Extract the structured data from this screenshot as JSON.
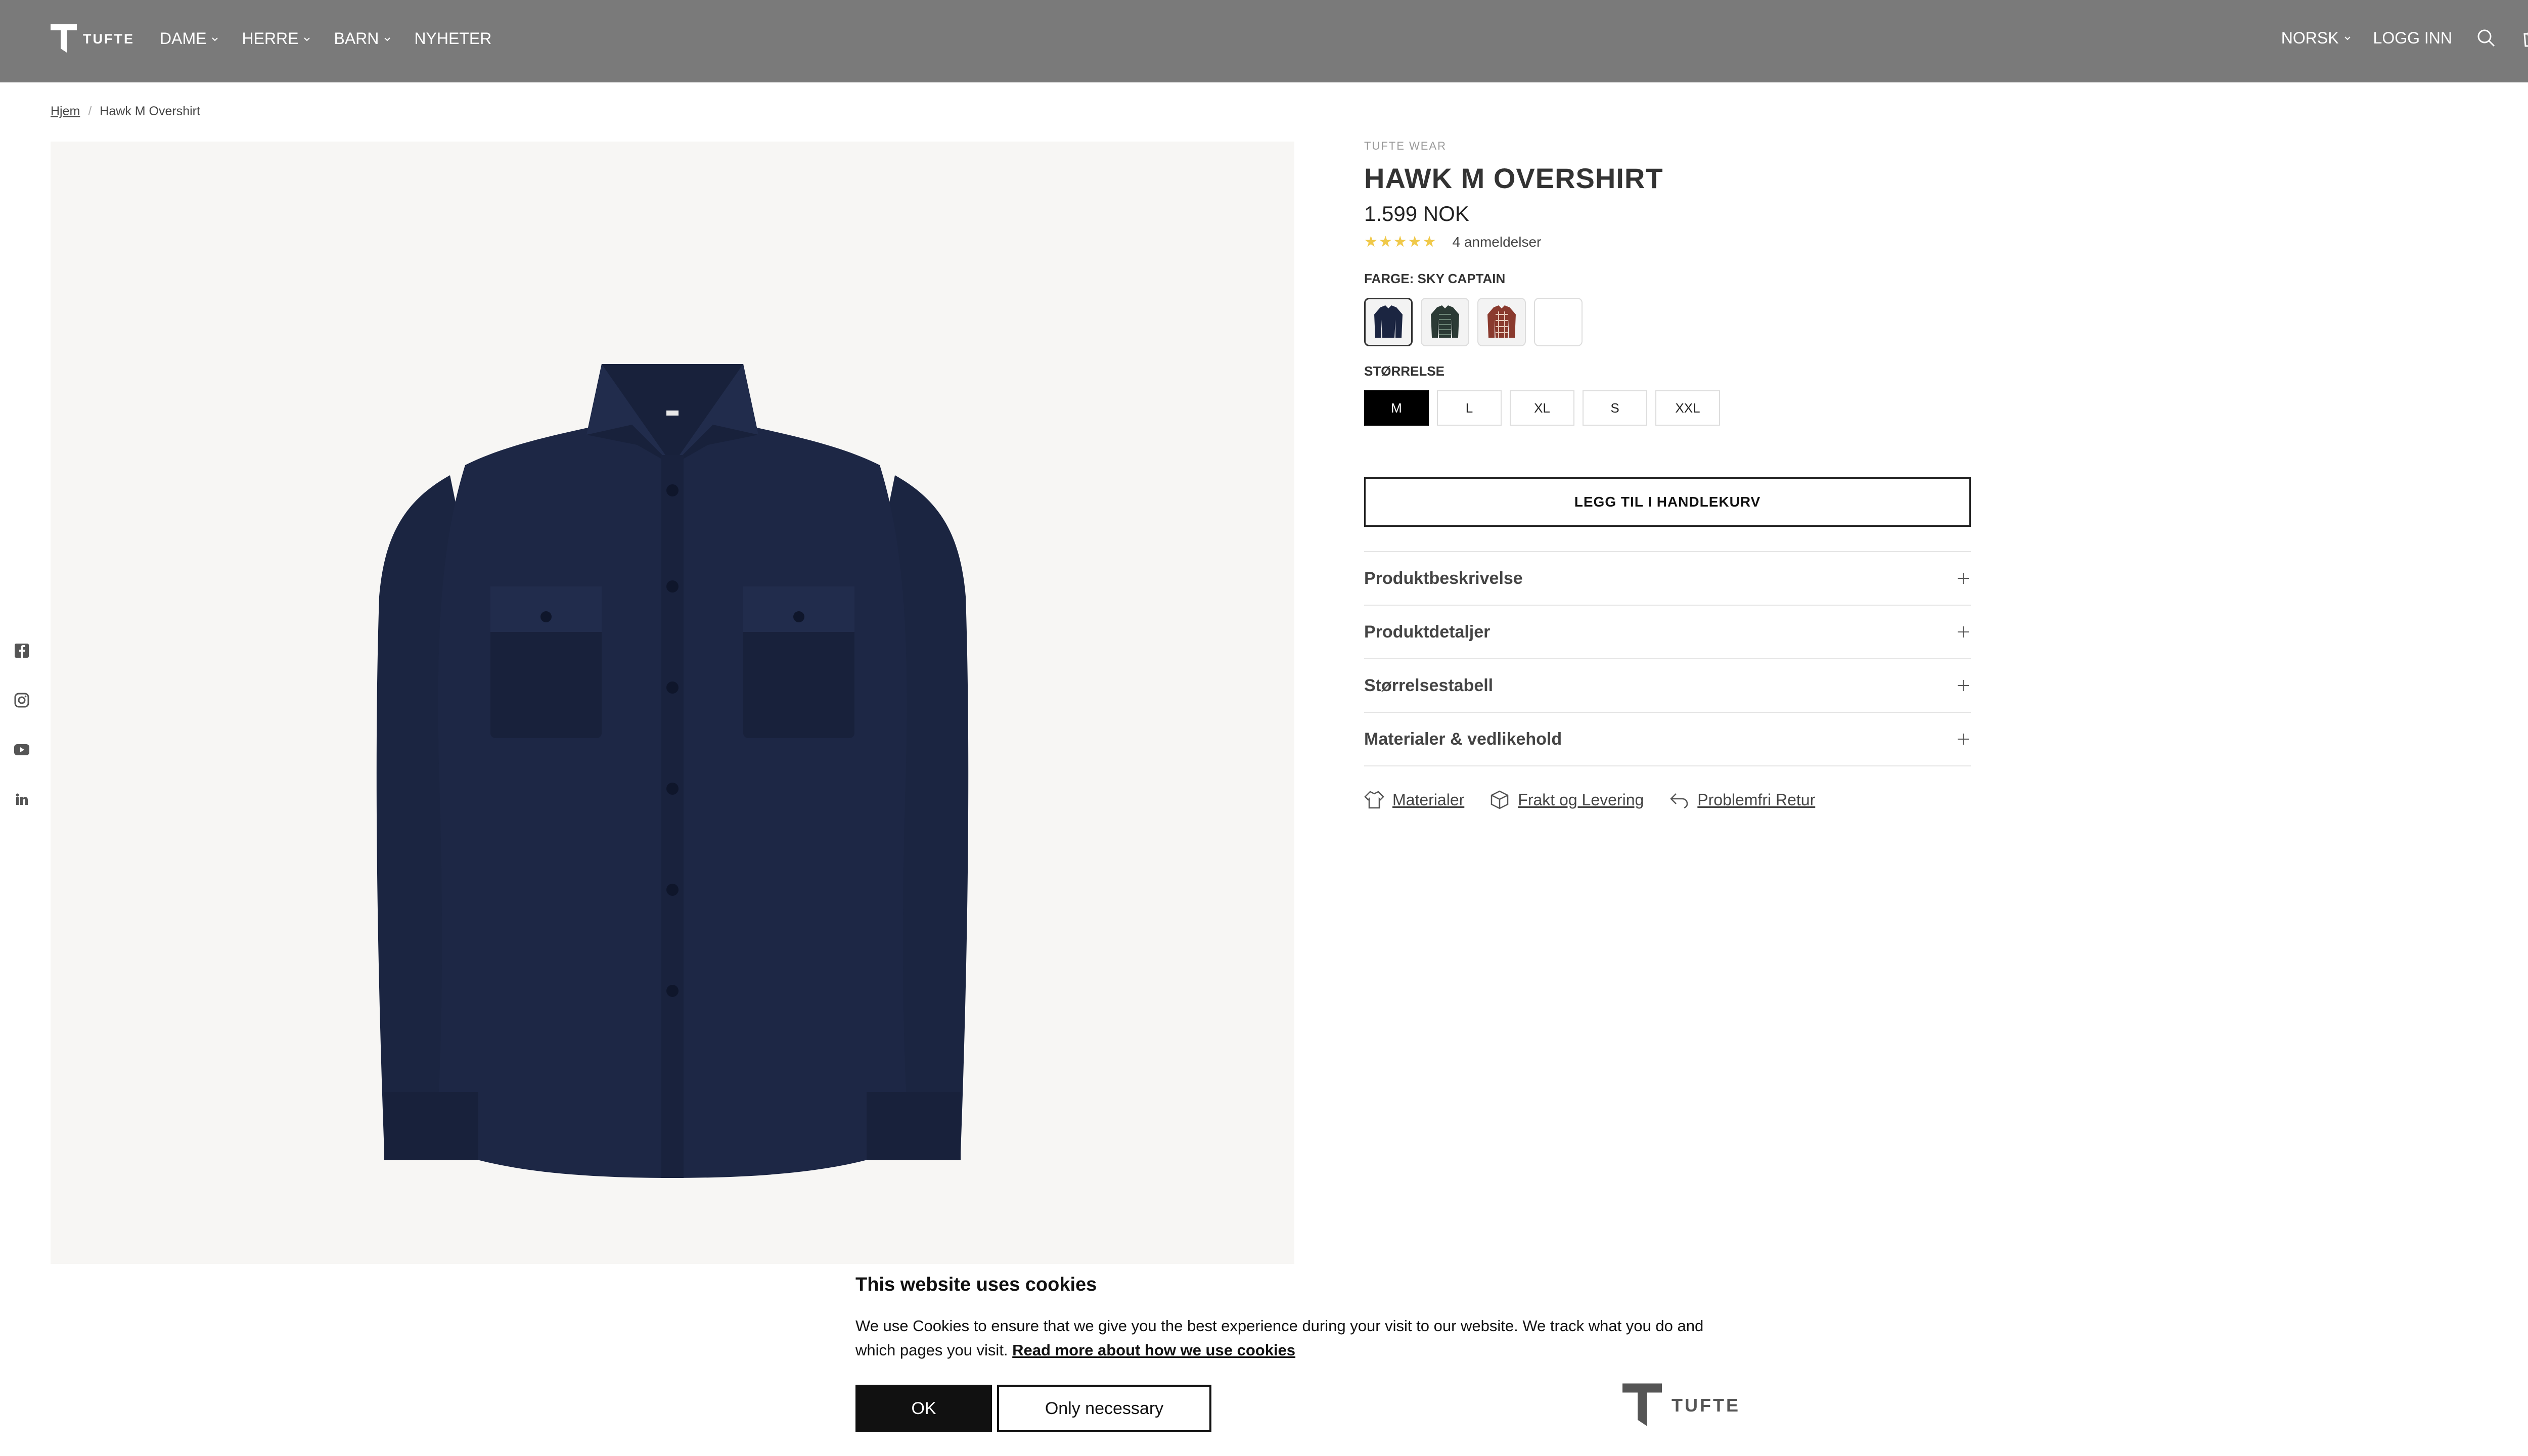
{
  "header": {
    "logo_text": "TUFTE",
    "nav": [
      {
        "label": "DAME",
        "has_dropdown": true
      },
      {
        "label": "HERRE",
        "has_dropdown": true
      },
      {
        "label": "BARN",
        "has_dropdown": true
      },
      {
        "label": "NYHETER",
        "has_dropdown": false
      }
    ],
    "language": "NORSK",
    "login": "LOGG INN",
    "cart_count": "0",
    "background_color": "#7a7a7a"
  },
  "breadcrumb": {
    "home": "Hjem",
    "current": "Hawk M Overshirt"
  },
  "social": [
    "facebook-icon",
    "instagram-icon",
    "youtube-icon",
    "linkedin-icon"
  ],
  "product": {
    "vendor": "TUFTE WEAR",
    "title": "HAWK M OVERSHIRT",
    "price": "1.599 NOK",
    "stars": "★★★★★",
    "reviews": "4 anmeldelser",
    "color_label": "FARGE: SKY CAPTAIN",
    "swatches": [
      "sky-captain",
      "green-check",
      "red-check",
      "blank"
    ],
    "size_label": "STØRRELSE",
    "sizes": [
      "M",
      "L",
      "XL",
      "S",
      "XXL"
    ],
    "selected_size": "M",
    "add_to_cart": "LEGG TIL I HANDLEKURV",
    "accordion": [
      "Produktbeskrivelse",
      "Produktdetaljer",
      "Størrelsestabell",
      "Materialer & vedlikehold"
    ],
    "feature_links": [
      "Materialer",
      "Frakt og Levering",
      "Problemfri Retur"
    ],
    "shirt_color": "#1b2541"
  },
  "cookie": {
    "title": "This website uses cookies",
    "text": "We use Cookies to ensure that we give you the best experience during your visit to our website. We track what you do and which pages you visit.",
    "link": "Read more about how we use cookies",
    "ok": "OK",
    "necessary": "Only necessary",
    "logo_text": "TUFTE"
  }
}
